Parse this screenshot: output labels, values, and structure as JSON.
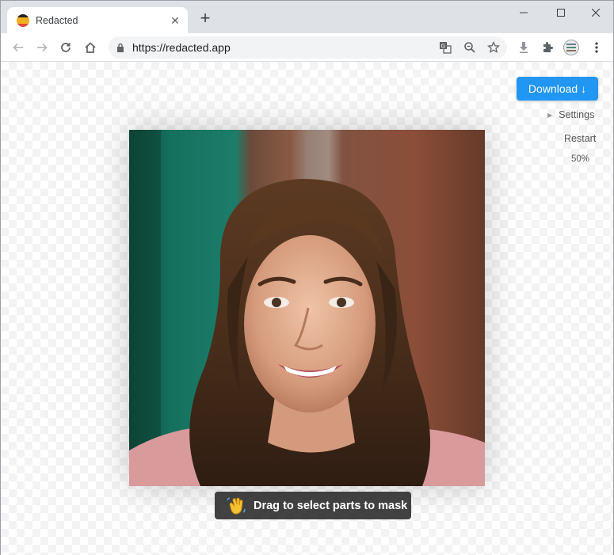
{
  "tab": {
    "title": "Redacted",
    "close_glyph": "✕"
  },
  "newtab_glyph": "+",
  "window_controls": [
    "minimize-icon",
    "maximize-icon",
    "close-icon"
  ],
  "toolbar": {
    "url": "https://redacted.app",
    "left_icons": [
      "back-arrow-icon",
      "forward-arrow-icon",
      "reload-icon",
      "home-icon"
    ],
    "right_icons": [
      "translate-icon",
      "zoom-icon",
      "bookmark-star-icon",
      "download-icon",
      "extensions-puzzle-icon",
      "profile-avatar-icon",
      "menu-kebab-icon"
    ]
  },
  "app": {
    "download_label": "Download ↓",
    "settings_label": "Settings",
    "restart_label": "Restart",
    "zoom_label": "50%",
    "hint_text": "Drag to select parts to mask",
    "hint_icon": "waving-hand-icon"
  },
  "colors": {
    "accent": "#2196f3",
    "tabstrip": "#dee1e6",
    "hint_bg": "#282828"
  }
}
